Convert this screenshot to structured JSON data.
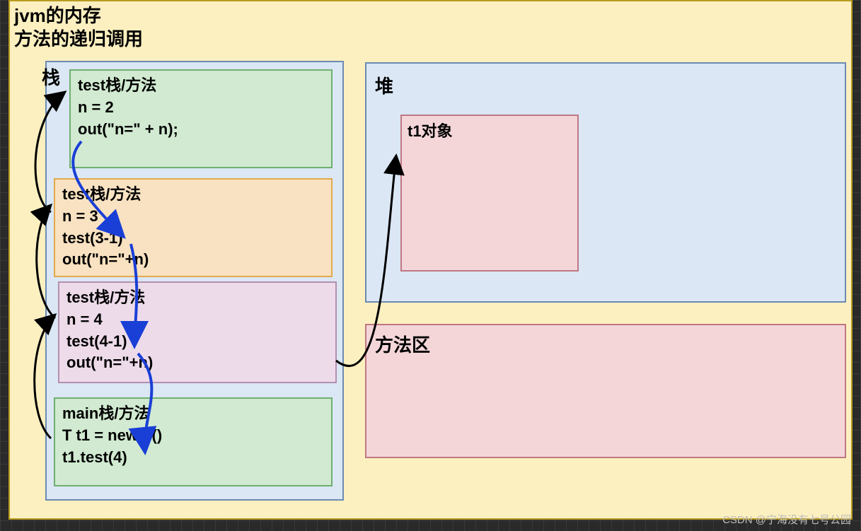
{
  "title_line1": "jvm的内存",
  "title_line2": "方法的递归调用",
  "stack_label": "栈",
  "heap_label": "堆",
  "method_area_label": "方法区",
  "heap_object_label": "t1对象",
  "frames": {
    "f0": "test栈/方法\nn = 2\nout(\"n=\" + n);",
    "f1": "test栈/方法\nn = 3\ntest(3-1)\nout(\"n=\"+n)",
    "f2": "test栈/方法\nn = 4\ntest(4-1)\nout(\"n=\"+n)",
    "f3": "main栈/方法\nT t1 = new T()\nt1.test(4)"
  },
  "watermark": "CSDN @宁海没有七号公园"
}
